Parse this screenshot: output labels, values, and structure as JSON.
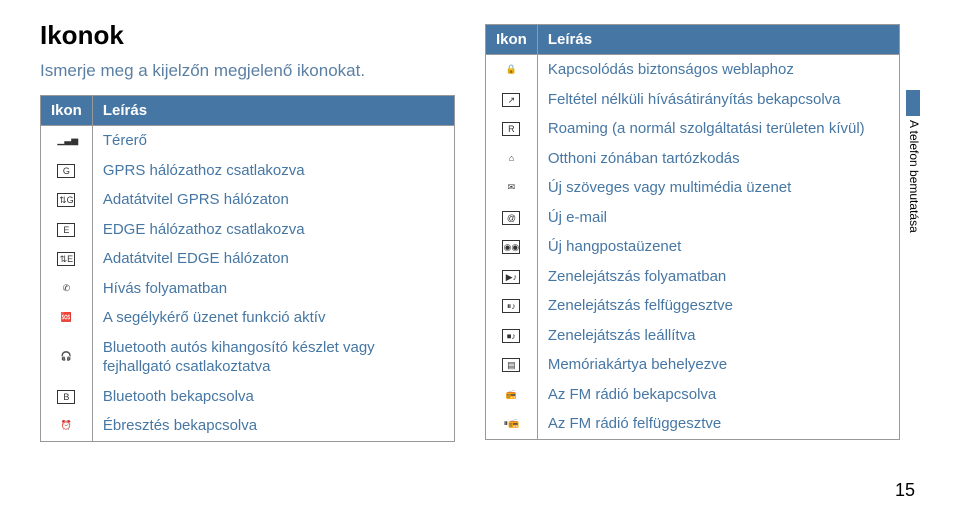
{
  "title": "Ikonok",
  "subtitle": "Ismerje meg a kijelzőn megjelenő ikonokat.",
  "header_icon": "Ikon",
  "header_desc": "Leírás",
  "side_label": "A telefon bemutatása",
  "page_number": "15",
  "left_rows": [
    {
      "glyph": "▁▃▅",
      "border": false,
      "desc": "Térerő"
    },
    {
      "glyph": "G",
      "border": true,
      "desc": "GPRS hálózathoz csatlakozva"
    },
    {
      "glyph": "⇅G",
      "border": true,
      "desc": "Adatátvitel GPRS hálózaton"
    },
    {
      "glyph": "E",
      "border": true,
      "desc": "EDGE hálózathoz csatlakozva"
    },
    {
      "glyph": "⇅E",
      "border": true,
      "desc": "Adatátvitel EDGE hálózaton"
    },
    {
      "glyph": "✆",
      "border": false,
      "desc": "Hívás folyamatban"
    },
    {
      "glyph": "🆘",
      "border": false,
      "desc": "A segélykérő üzenet funkció aktív"
    },
    {
      "glyph": "🎧",
      "border": false,
      "desc": "Bluetooth autós kihangosító készlet vagy fejhallgató csatlakoztatva"
    },
    {
      "glyph": "B",
      "border": true,
      "desc": "Bluetooth bekapcsolva"
    },
    {
      "glyph": "⏰",
      "border": false,
      "desc": "Ébresztés bekapcsolva"
    }
  ],
  "right_rows": [
    {
      "glyph": "🔒",
      "border": false,
      "desc": "Kapcsolódás biztonságos weblaphoz"
    },
    {
      "glyph": "↗",
      "border": true,
      "desc": "Feltétel nélküli hívásátirányítás bekapcsolva"
    },
    {
      "glyph": "R",
      "border": true,
      "desc": "Roaming (a normál szolgáltatási területen kívül)"
    },
    {
      "glyph": "⌂",
      "border": false,
      "desc": "Otthoni zónában tartózkodás"
    },
    {
      "glyph": "✉",
      "border": false,
      "desc": "Új szöveges vagy multimédia üzenet"
    },
    {
      "glyph": "@",
      "border": true,
      "desc": "Új e-mail"
    },
    {
      "glyph": "◉◉",
      "border": true,
      "desc": "Új hangpostaüzenet"
    },
    {
      "glyph": "▶♪",
      "border": true,
      "desc": "Zenelejátszás folyamatban"
    },
    {
      "glyph": "⏸♪",
      "border": true,
      "desc": "Zenelejátszás felfüggesztve"
    },
    {
      "glyph": "⏹♪",
      "border": true,
      "desc": "Zenelejátszás leállítva"
    },
    {
      "glyph": "▤",
      "border": true,
      "desc": "Memóriakártya behelyezve"
    },
    {
      "glyph": "📻",
      "border": false,
      "desc": "Az FM rádió bekapcsolva"
    },
    {
      "glyph": "⏸📻",
      "border": false,
      "desc": "Az FM rádió felfüggesztve"
    }
  ]
}
